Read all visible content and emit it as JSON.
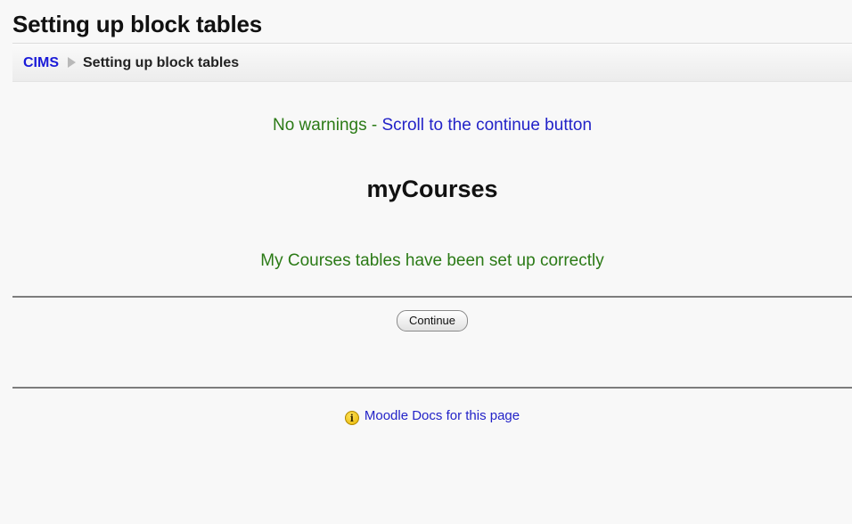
{
  "page": {
    "title": "Setting up block tables"
  },
  "breadcrumb": {
    "home_label": "CIMS",
    "current_label": "Setting up block tables"
  },
  "main": {
    "warnings_text": "No warnings - ",
    "scroll_link_text": "Scroll to the continue button",
    "block_name": "myCourses",
    "success_text": "My Courses tables have been set up correctly",
    "continue_label": "Continue"
  },
  "footer": {
    "docs_icon": "info-icon",
    "docs_icon_glyph": "i",
    "docs_link_text": "Moodle Docs for this page"
  },
  "colors": {
    "notice_green": "#2b7a16",
    "link_blue": "#2323c8"
  }
}
